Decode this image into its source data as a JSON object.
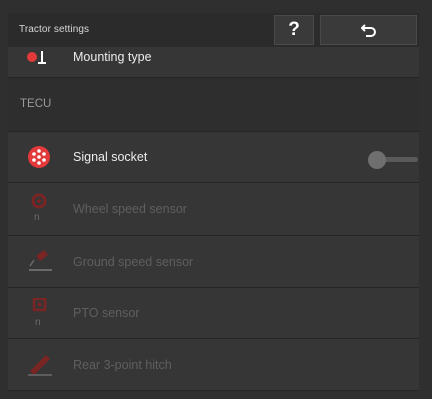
{
  "header": {
    "title": "Tractor settings",
    "help_label": "?",
    "back_icon": "return-arrow-icon"
  },
  "list": {
    "items": [
      {
        "label": "Mounting type",
        "icon": "mounting-type-icon",
        "enabled": true
      },
      {
        "label": "TECU",
        "type": "section"
      },
      {
        "label": "Signal socket",
        "icon": "signal-socket-icon",
        "enabled": true,
        "toggle": "off"
      },
      {
        "label": "Wheel speed sensor",
        "icon": "wheel-speed-sensor-icon",
        "enabled": false
      },
      {
        "label": "Ground speed sensor",
        "icon": "ground-speed-sensor-icon",
        "enabled": false
      },
      {
        "label": "PTO sensor",
        "icon": "pto-sensor-icon",
        "enabled": false
      },
      {
        "label": "Rear 3-point hitch",
        "icon": "rear-hitch-icon",
        "enabled": false
      }
    ]
  },
  "colors": {
    "accent_red": "#e23a3a",
    "disabled_red": "#7a2424",
    "background": "#2f2f2f"
  }
}
